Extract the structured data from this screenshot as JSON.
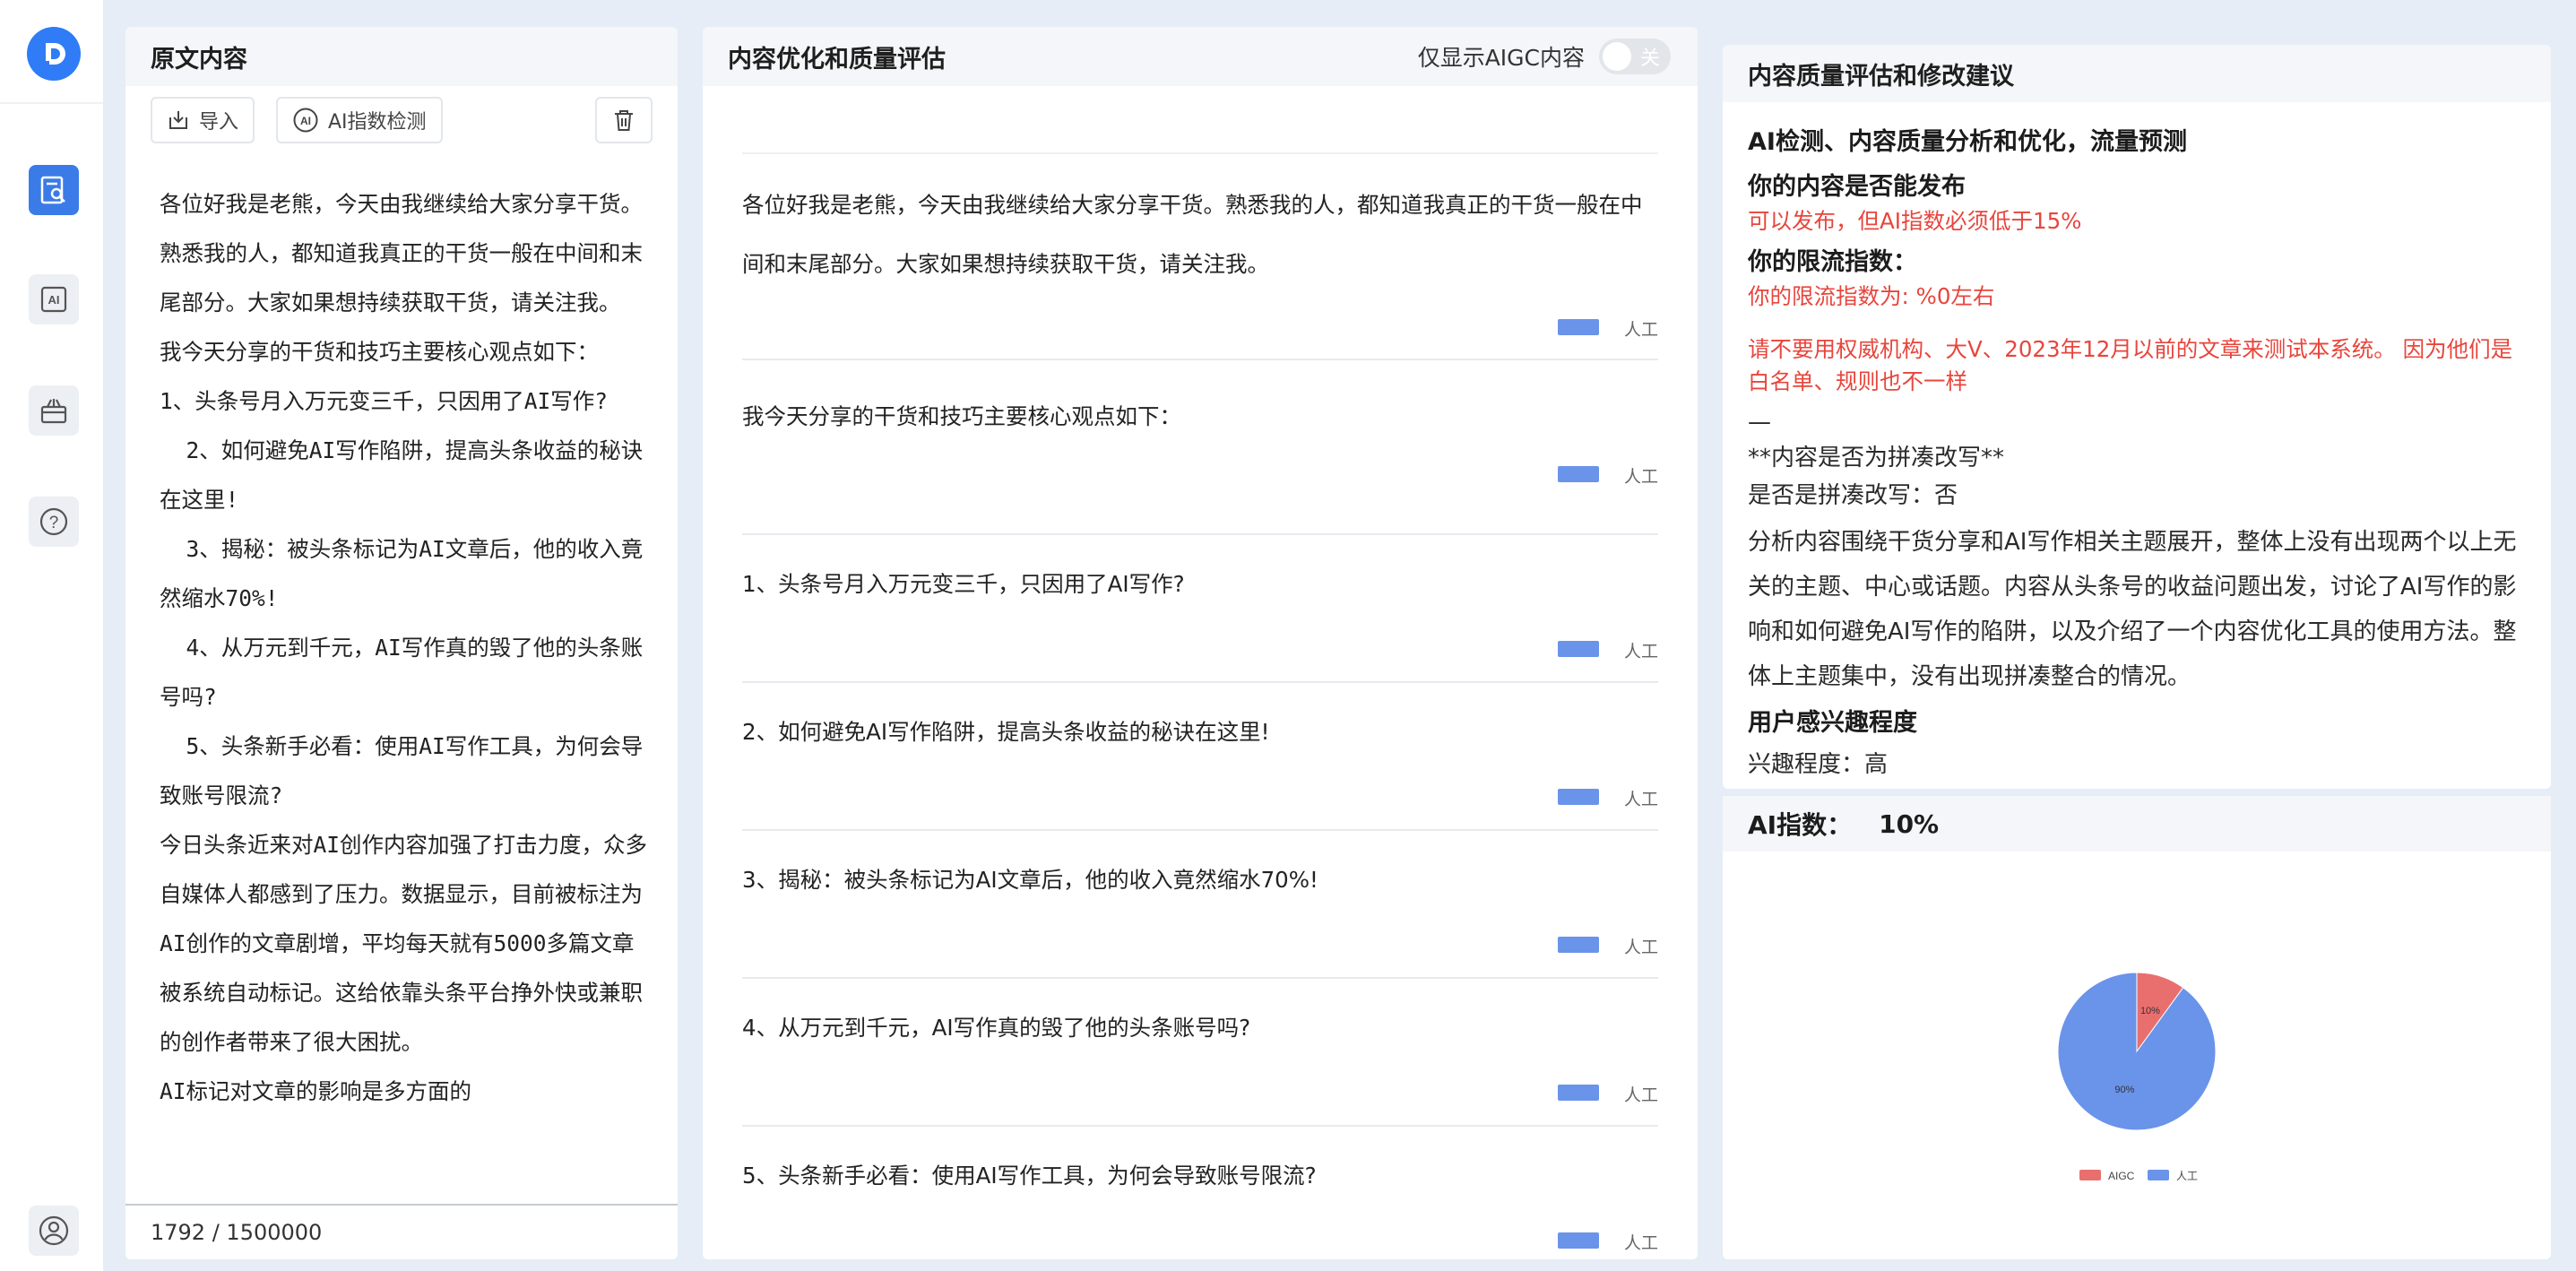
{
  "app": {
    "colors": {
      "accent": "#3b7be8",
      "warning": "#e8453c",
      "aigc": "#e96f6f",
      "human": "#6a93ea"
    }
  },
  "sidebar": {
    "items": [
      {
        "name": "content-check",
        "icon": "document-search-icon",
        "active": true
      },
      {
        "name": "ai",
        "icon": "ai-icon",
        "label": "AI"
      },
      {
        "name": "tools",
        "icon": "toolbox-icon"
      },
      {
        "name": "help",
        "icon": "help-icon",
        "label": "?"
      },
      {
        "name": "account",
        "icon": "user-icon"
      }
    ]
  },
  "left_panel": {
    "title": "原文内容",
    "import_label": "导入",
    "ai_check_label": "AI指数检测",
    "original_text": "各位好我是老熊，今天由我继续给大家分享干货。熟悉我的人，都知道我真正的干货一般在中间和末尾部分。大家如果想持续获取干货，请关注我。\n我今天分享的干货和技巧主要核心观点如下：\n1、头条号月入万元变三千，只因用了AI写作?\n  2、如何避免AI写作陷阱，提高头条收益的秘诀在这里!\n  3、揭秘：被头条标记为AI文章后，他的收入竟然缩水70%!\n  4、从万元到千元，AI写作真的毁了他的头条账号吗?\n  5、头条新手必看：使用AI写作工具，为何会导致账号限流?\n今日头条近来对AI创作内容加强了打击力度，众多自媒体人都感到了压力。数据显示，目前被标注为AI创作的文章剧增，平均每天就有5000多篇文章被系统自动标记。这给依靠头条平台挣外快或兼职的创作者带来了很大困扰。\nAI标记对文章的影响是多方面的",
    "counter": "1792 / 1500000"
  },
  "middle_panel": {
    "title": "内容优化和质量评估",
    "toggle_label": "仅显示AIGC内容",
    "toggle_state": "关",
    "segments": [
      {
        "text": "各位好我是老熊，今天由我继续给大家分享干货。熟悉我的人，都知道我真正的干货一般在中间和末尾部分。大家如果想持续获取干货，请关注我。",
        "tag": "人工"
      },
      {
        "text": "我今天分享的干货和技巧主要核心观点如下：",
        "tag": "人工"
      },
      {
        "text": "1、头条号月入万元变三千，只因用了AI写作?",
        "tag": "人工"
      },
      {
        "text": "2、如何避免AI写作陷阱，提高头条收益的秘诀在这里!",
        "tag": "人工"
      },
      {
        "text": "3、揭秘：被头条标记为AI文章后，他的收入竟然缩水70%!",
        "tag": "人工"
      },
      {
        "text": "4、从万元到千元，AI写作真的毁了他的头条账号吗?",
        "tag": "人工"
      },
      {
        "text": "5、头条新手必看：使用AI写作工具，为何会导致账号限流?",
        "tag": "人工"
      }
    ]
  },
  "right_panel": {
    "title": "内容质量评估和修改建议",
    "heading": "AI检测、内容质量分析和优化，流量预测",
    "publish_q": "你的内容是否能发布",
    "publish_a": "可以发布，但AI指数必须低于15%",
    "limit_q": "你的限流指数：",
    "limit_a": "你的限流指数为: %0左右",
    "warning": "请不要用权威机构、大V、2023年12月以前的文章来测试本系统。 因为他们是白名单、规则也不一样",
    "divider": "—",
    "patchwork_title": "**内容是否为拼凑改写**",
    "patchwork_answer": "是否是拼凑改写：否",
    "analysis": "分析内容围绕干货分享和AI写作相关主题展开，整体上没有出现两个以上无关的主题、中心或话题。内容从头条号的收益问题出发，讨论了AI写作的影响和如何避免AI写作的陷阱，以及介绍了一个内容优化工具的使用方法。整体上主题集中，没有出现拼凑整合的情况。",
    "interest_title": "用户感兴趣程度",
    "interest_value": "兴趣程度：高",
    "ai_index_label": "AI指数：",
    "ai_index_value": "10%"
  },
  "chart_data": {
    "type": "pie",
    "categories": [
      "AIGC",
      "人工"
    ],
    "values": [
      10,
      90
    ],
    "labels": [
      "10%",
      "90%"
    ],
    "colors": [
      "#e96f6f",
      "#6a93ea"
    ],
    "legend": "bottom"
  }
}
